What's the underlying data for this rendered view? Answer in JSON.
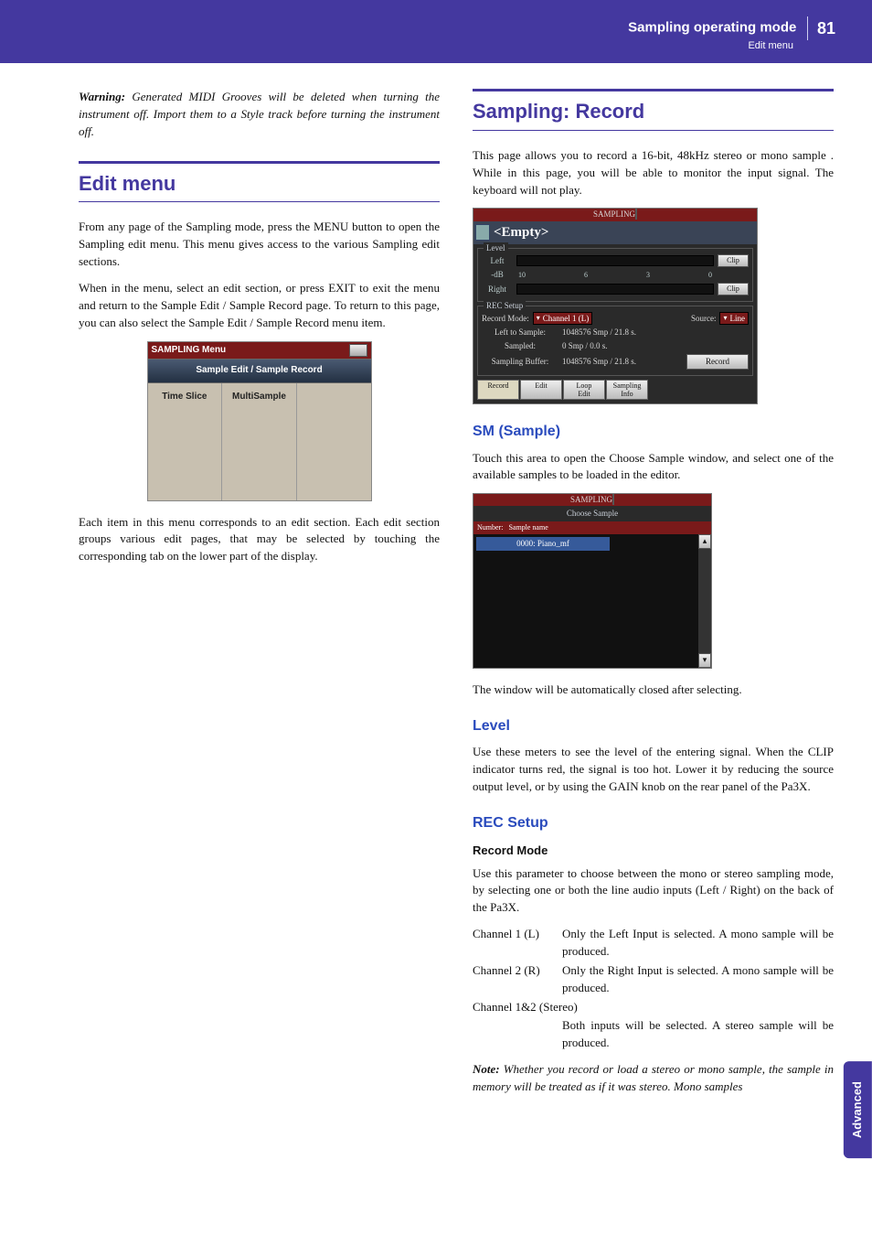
{
  "header": {
    "title": "Sampling operating mode",
    "subtitle": "Edit menu",
    "page_number": "81"
  },
  "side_tab": "Advanced",
  "left": {
    "warning_label": "Warning:",
    "warning_text": "Generated MIDI Grooves will be deleted when turning the instrument off. Import them to a Style track before turning the instrument off.",
    "h1": "Edit menu",
    "p1": "From any page of the Sampling mode, press the MENU button to open the Sampling edit menu. This menu gives access to the various Sampling edit sections.",
    "p2": "When in the menu, select an edit section, or press EXIT to exit the menu and return to the Sample Edit / Sample Record page. To return to this page, you can also select the Sample Edit / Sample Record menu item.",
    "p3": "Each item in this menu corresponds to an edit section. Each edit section groups various edit pages, that may be selected by touching the corresponding tab on the lower part of the display.",
    "fig1": {
      "title": "SAMPLING Menu",
      "band": "Sample Edit / Sample Record",
      "cell1": "Time Slice",
      "cell2": "MultiSample"
    }
  },
  "right": {
    "h1": "Sampling: Record",
    "p1": "This page allows you to record a 16-bit, 48kHz stereo or mono sample . While in this page, you will be able to monitor the input signal. The keyboard will not play.",
    "fig2": {
      "title": "SAMPLING",
      "sample_name": "<Empty>",
      "level_legend": "Level",
      "left_label": "Left",
      "right_label": "Right",
      "db_label": "-dB",
      "db_ticks": [
        "10",
        "6",
        "3",
        "0"
      ],
      "clip": "Clip",
      "rec_legend": "REC Setup",
      "record_mode_label": "Record Mode:",
      "record_mode_value": "Channel 1 (L)",
      "source_label": "Source:",
      "source_value": "Line",
      "left_to_sample_label": "Left to Sample:",
      "left_to_sample_value": "1048576 Smp /  21.8 s.",
      "sampled_label": "Sampled:",
      "sampled_value": "0 Smp /   0.0 s.",
      "buffer_label": "Sampling Buffer:",
      "buffer_value": "1048576 Smp /  21.8 s.",
      "record_btn": "Record",
      "tabs": [
        "Record",
        "Edit",
        "Loop\nEdit",
        "Sampling\nInfo"
      ]
    },
    "h2a": "SM (Sample)",
    "p2": "Touch this area to open the Choose Sample window, and select one of the available samples to be loaded in the editor.",
    "fig3": {
      "title": "SAMPLING",
      "choose": "Choose Sample",
      "col1": "Number:",
      "col2": "Sample name",
      "row": "0000: Piano_mf"
    },
    "p3": "The window will be automatically closed after selecting.",
    "h2b": "Level",
    "p4": "Use these meters to see the level of the entering signal. When the CLIP indicator turns red, the signal is too hot. Lower it by reducing the source output level, or by using the GAIN knob on the rear panel of the Pa3X.",
    "h2c": "REC Setup",
    "h3a": "Record Mode",
    "p5": "Use this parameter to choose between the mono or stereo sampling mode, by selecting one or both the line audio inputs (Left / Right) on the back of the Pa3X.",
    "defs": [
      {
        "term": "Channel 1 (L)",
        "desc": "Only the Left Input is selected. A mono sample will be produced."
      },
      {
        "term": "Channel 2 (R)",
        "desc": "Only the Right Input is selected. A mono sample will be produced."
      },
      {
        "term": "Channel 1&2 (Stereo)",
        "desc": "Both inputs will be selected. A stereo sample will be produced."
      }
    ],
    "note_label": "Note:",
    "note_text": "Whether you record or load a stereo or mono sample, the sample in memory will be treated as if it was stereo. Mono samples"
  }
}
